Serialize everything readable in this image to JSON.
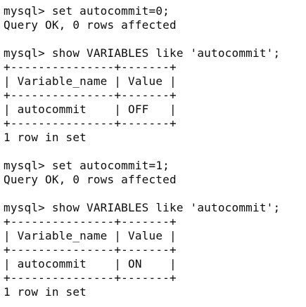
{
  "terminal": {
    "lines": [
      "mysql> set autocommit=0;",
      "Query OK, 0 rows affected",
      "",
      "mysql> show VARIABLES like 'autocommit';",
      "+---------------+-------+",
      "| Variable_name | Value |",
      "+---------------+-------+",
      "| autocommit    | OFF   |",
      "+---------------+-------+",
      "1 row in set",
      "",
      "mysql> set autocommit=1;",
      "Query OK, 0 rows affected",
      "",
      "mysql> show VARIABLES like 'autocommit';",
      "+---------------+-------+",
      "| Variable_name | Value |",
      "+---------------+-------+",
      "| autocommit    | ON    |",
      "+---------------+-------+",
      "1 row in set"
    ]
  }
}
